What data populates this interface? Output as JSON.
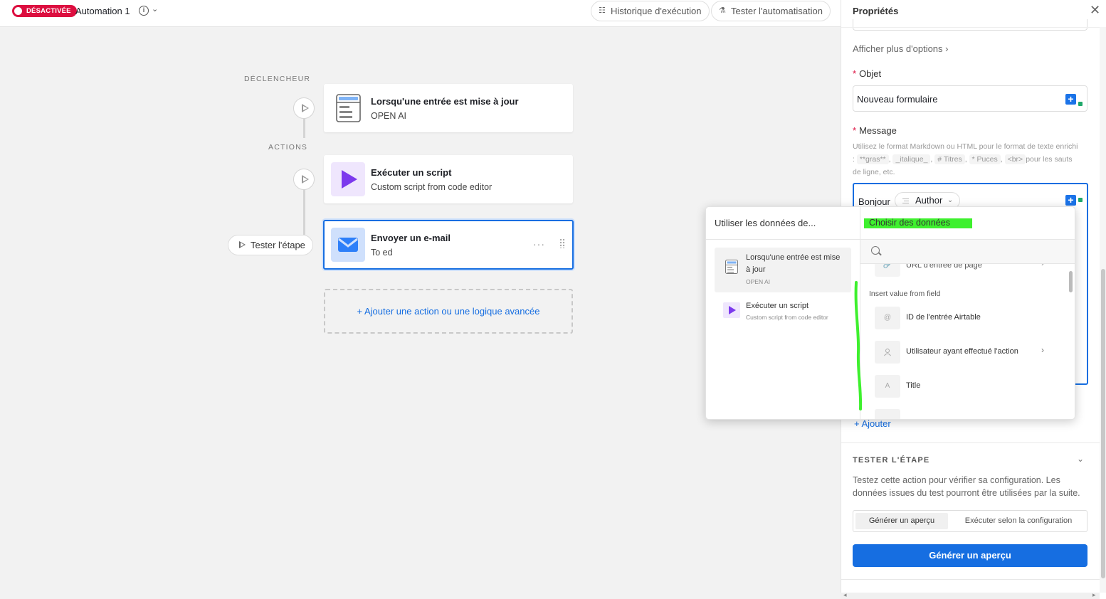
{
  "topbar": {
    "status_badge": "DÉSACTIVÉE",
    "automation_name": "Automation 1",
    "history_button": "Historique d'exécution",
    "test_automation_button": "Tester l'automatisation"
  },
  "canvas": {
    "trigger_label": "DÉCLENCHEUR",
    "actions_label": "ACTIONS",
    "trigger_node": {
      "title": "Lorsqu'une entrée est mise à jour",
      "subtitle": "OPEN AI"
    },
    "script_node": {
      "title": "Exécuter un script",
      "subtitle": "Custom script from code editor"
    },
    "email_node": {
      "title": "Envoyer un e-mail",
      "subtitle": "To ed",
      "more": "···"
    },
    "test_step_button": "Tester l'étape",
    "add_action_button": "+ Ajouter une action ou une logique avancée"
  },
  "panel": {
    "title": "Propriétés",
    "more_options": "Afficher plus d'options ›",
    "subject_label": "Objet",
    "subject_value": "Nouveau formulaire",
    "message_label": "Message",
    "help_prefix": "Utilisez le format Markdown ou HTML pour le format de texte enrichi :",
    "help_chips": [
      "**gras**",
      "_italique_",
      "# Titres",
      "* Puces"
    ],
    "help_br_chip": "<br>",
    "help_suffix": "pour les sauts de ligne,",
    "help_etc": "etc.",
    "message_text": "Bonjour",
    "author_pill": "Author",
    "add_button": "+ Ajouter",
    "test_section": {
      "heading": "TESTER L'ÉTAPE",
      "description": "Testez cette action pour vérifier sa configuration. Les données issues du test pourront être utilisées par la suite.",
      "option_preview": "Générer un aperçu",
      "option_config": "Exécuter selon la configuration",
      "primary_button": "Générer un aperçu"
    }
  },
  "popover": {
    "left_title": "Utiliser les données de...",
    "right_title": "Choisir des données",
    "sources": [
      {
        "title": "Lorsqu'une entrée est mise à jour",
        "subtitle": "OPEN AI"
      },
      {
        "title": "Exécuter un script",
        "subtitle": "Custom script from code editor"
      }
    ],
    "partial_row": "URL d'entrée de page",
    "group_header": "Insert value from field",
    "fields": [
      {
        "label": "ID de l'entrée Airtable",
        "icon": "@",
        "has_children": false
      },
      {
        "label": "Utilisateur ayant effectué l'action",
        "icon": "user-icon",
        "has_children": true
      },
      {
        "label": "Title",
        "icon": "A",
        "has_children": false
      }
    ]
  },
  "colors": {
    "accent": "#166ee1",
    "badge": "#dc0e3f",
    "highlight": "#3ef02e",
    "script_purple": "#7c39ed",
    "email_blue": "#2d7ff9"
  }
}
